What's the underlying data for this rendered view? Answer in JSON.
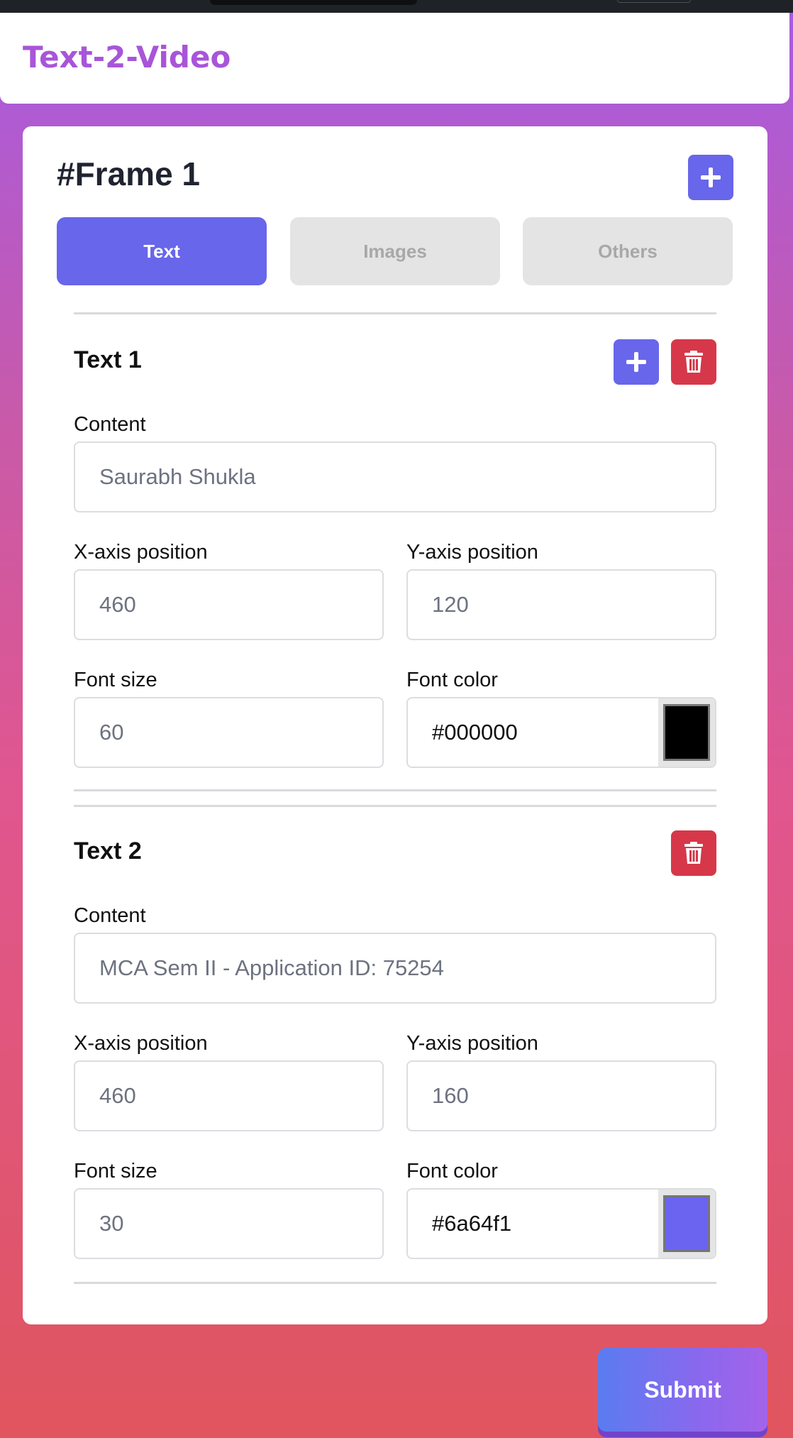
{
  "app": {
    "title": "Text-2-Video"
  },
  "frame": {
    "title": "#Frame 1",
    "tabs": [
      {
        "label": "Text",
        "active": true
      },
      {
        "label": "Images",
        "active": false
      },
      {
        "label": "Others",
        "active": false
      }
    ]
  },
  "texts": [
    {
      "title": "Text 1",
      "content_label": "Content",
      "content_placeholder": "Saurabh Shukla",
      "x_label": "X-axis position",
      "x_value": "460",
      "y_label": "Y-axis position",
      "y_value": "120",
      "size_label": "Font size",
      "size_value": "60",
      "color_label": "Font color",
      "color_value": "#000000",
      "swatch_color": "#000000"
    },
    {
      "title": "Text 2",
      "content_label": "Content",
      "content_placeholder": "MCA Sem II - Application ID: 75254",
      "x_label": "X-axis position",
      "x_value": "460",
      "y_label": "Y-axis position",
      "y_value": "160",
      "size_label": "Font size",
      "size_value": "30",
      "color_label": "Font color",
      "color_value": "#6a64f1",
      "swatch_color": "#6a64f1"
    }
  ],
  "icons": {
    "add": "plus-icon",
    "delete": "trash-icon"
  },
  "colors": {
    "accent": "#6866ea",
    "danger": "#d6384a",
    "brand": "#a855d9"
  },
  "submit_label": "Submit"
}
